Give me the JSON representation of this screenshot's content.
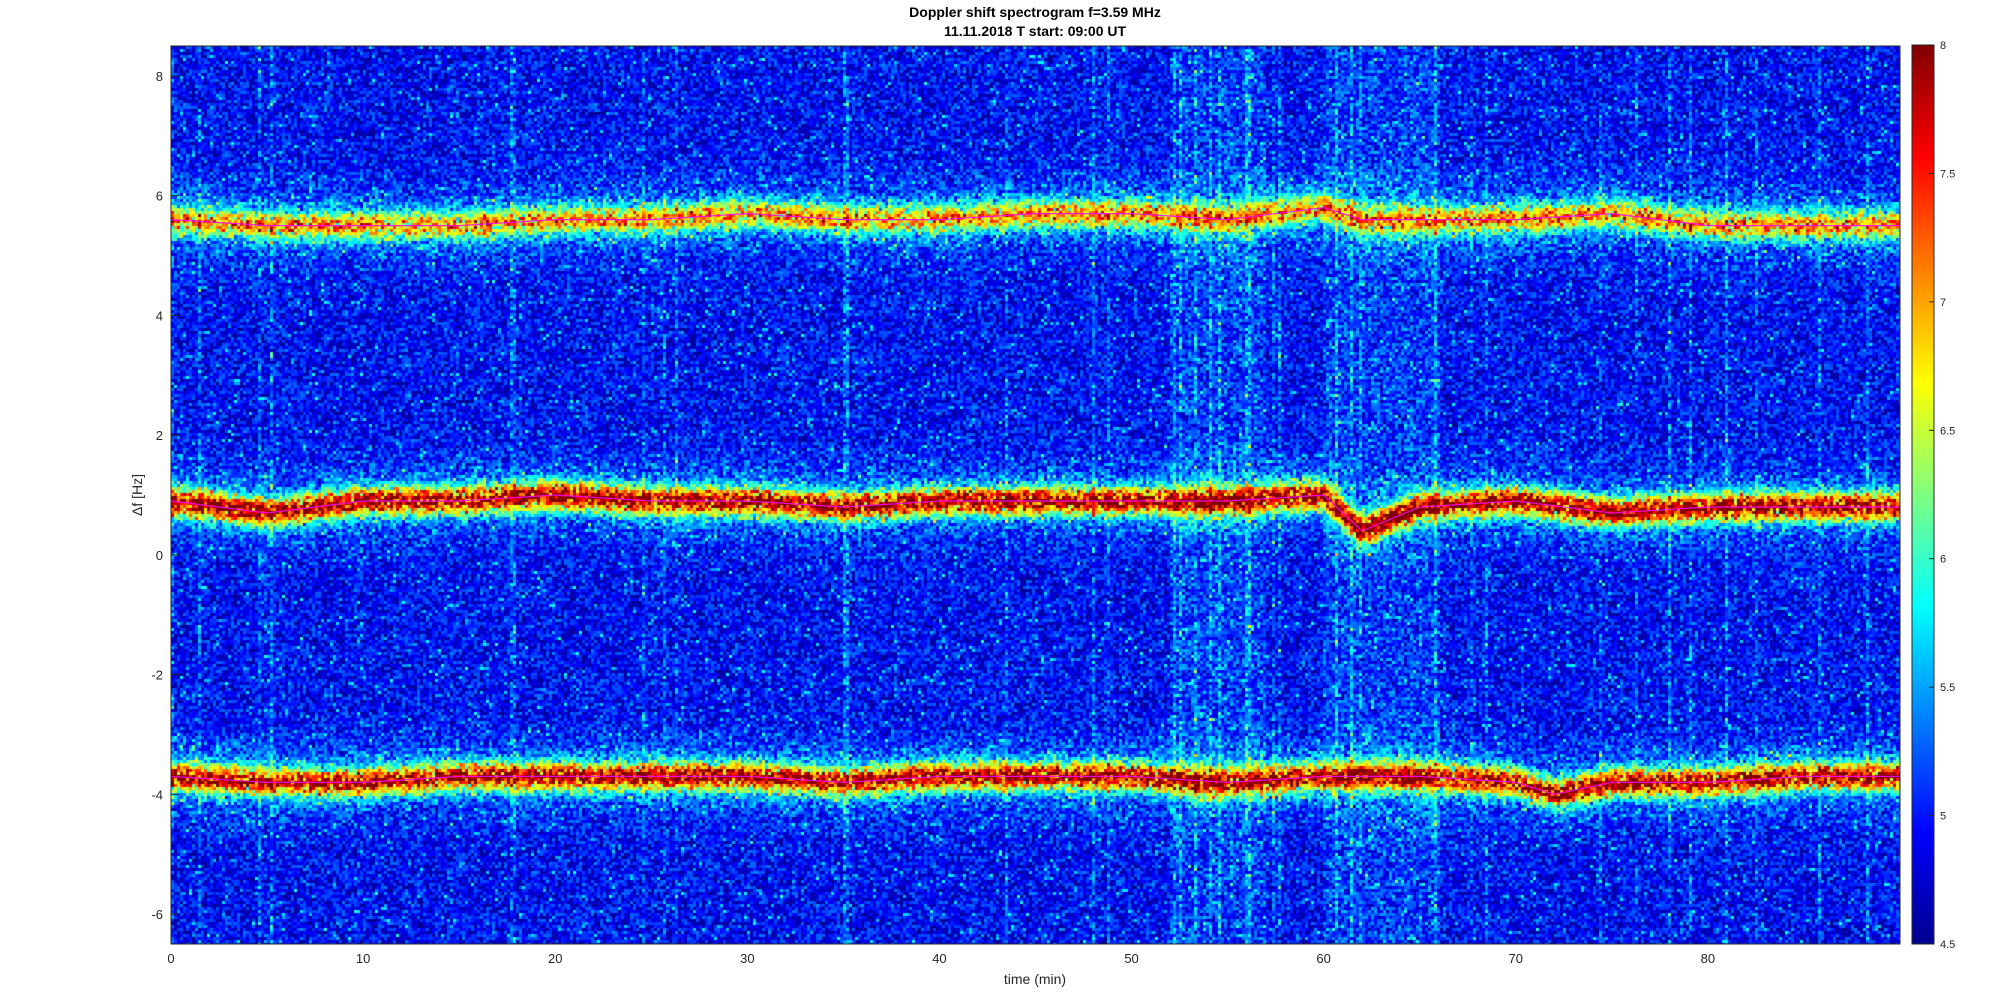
{
  "chart_data": {
    "type": "heatmap",
    "title": "Doppler shift spectrogram f=3.59 MHz",
    "subtitle": "11.11.2018   T start: 09:00 UT",
    "xlabel": "time (min)",
    "ylabel": "Δf [Hz]",
    "xlim": [
      0,
      90
    ],
    "ylim": [
      -6.5,
      8.5
    ],
    "x_ticks": [
      0,
      10,
      20,
      30,
      40,
      50,
      60,
      70,
      80
    ],
    "y_ticks": [
      -6,
      -4,
      -2,
      0,
      2,
      4,
      6,
      8
    ],
    "colorbar": {
      "colormap": "jet",
      "clim": [
        4.5,
        8
      ],
      "ticks": [
        4.5,
        5,
        5.5,
        6,
        6.5,
        7,
        7.5,
        8
      ]
    },
    "grid": false,
    "traces": [
      {
        "x": [
          0,
          5,
          10,
          15,
          20,
          25,
          30,
          35,
          40,
          45,
          50,
          55,
          60,
          62,
          65,
          70,
          75,
          80,
          85,
          90
        ],
        "y": [
          5.6,
          5.5,
          5.5,
          5.5,
          5.6,
          5.6,
          5.7,
          5.6,
          5.6,
          5.7,
          5.7,
          5.6,
          5.8,
          5.6,
          5.6,
          5.6,
          5.7,
          5.5,
          5.5,
          5.5
        ],
        "peak_intensity": 6.6,
        "color": "#ff00ff"
      },
      {
        "x": [
          0,
          5,
          10,
          15,
          20,
          25,
          30,
          35,
          40,
          45,
          50,
          55,
          60,
          62,
          65,
          70,
          75,
          80,
          85,
          90
        ],
        "y": [
          0.9,
          0.7,
          0.9,
          0.9,
          1.0,
          0.9,
          0.9,
          0.8,
          0.9,
          0.9,
          0.9,
          0.9,
          1.0,
          0.4,
          0.8,
          0.9,
          0.7,
          0.8,
          0.8,
          0.8
        ],
        "peak_intensity": 7.6,
        "color": "#ff00ff"
      },
      {
        "x": [
          0,
          5,
          10,
          15,
          20,
          25,
          30,
          35,
          40,
          45,
          50,
          55,
          60,
          65,
          70,
          72,
          75,
          80,
          85,
          90
        ],
        "y": [
          -3.7,
          -3.8,
          -3.8,
          -3.7,
          -3.7,
          -3.7,
          -3.7,
          -3.8,
          -3.7,
          -3.7,
          -3.7,
          -3.8,
          -3.7,
          -3.7,
          -3.8,
          -4.0,
          -3.8,
          -3.8,
          -3.7,
          -3.7
        ],
        "peak_intensity": 7.5,
        "color": "#ff00ff"
      }
    ],
    "annotations": [
      {
        "type": "noise-burst",
        "x_range": [
          52,
          57
        ],
        "y_range": [
          5.8,
          6.8
        ]
      },
      {
        "type": "noise-burst",
        "x_range": [
          60,
          66
        ],
        "y_range": [
          -6.5,
          8.5
        ]
      }
    ]
  }
}
